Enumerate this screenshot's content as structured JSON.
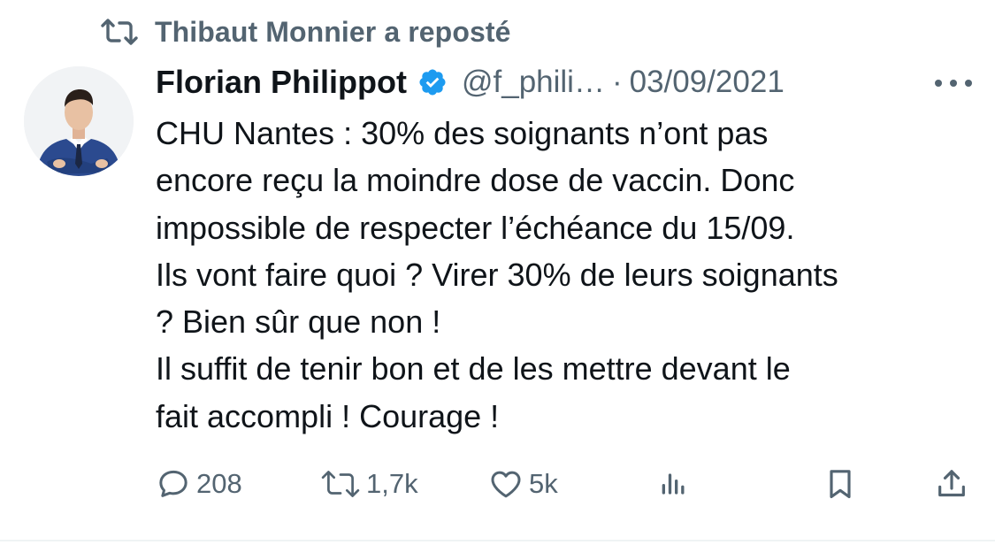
{
  "repost": {
    "text": "Thibaut Monnier a reposté",
    "icon": "repost-icon"
  },
  "author": {
    "display_name": "Florian Philippot",
    "handle": "@f_phili…",
    "separator": "·",
    "date": "03/09/2021",
    "verified": true,
    "verified_color": "#1d9bf0"
  },
  "body": {
    "lines": [
      "CHU Nantes : 30% des soignants n’ont pas",
      "encore reçu la moindre dose de vaccin. Donc",
      "impossible de respecter l’échéance du 15/09.",
      "Ils vont faire quoi ? Virer 30% de leurs soignants",
      "? Bien sûr que non !",
      "Il suffit de tenir bon et de les mettre devant le",
      "fait accompli ! Courage !"
    ]
  },
  "actions": {
    "reply_count": "208",
    "repost_count": "1,7k",
    "like_count": "5k"
  },
  "colors": {
    "text": "#0f1419",
    "muted": "#536471",
    "accent": "#1d9bf0"
  }
}
